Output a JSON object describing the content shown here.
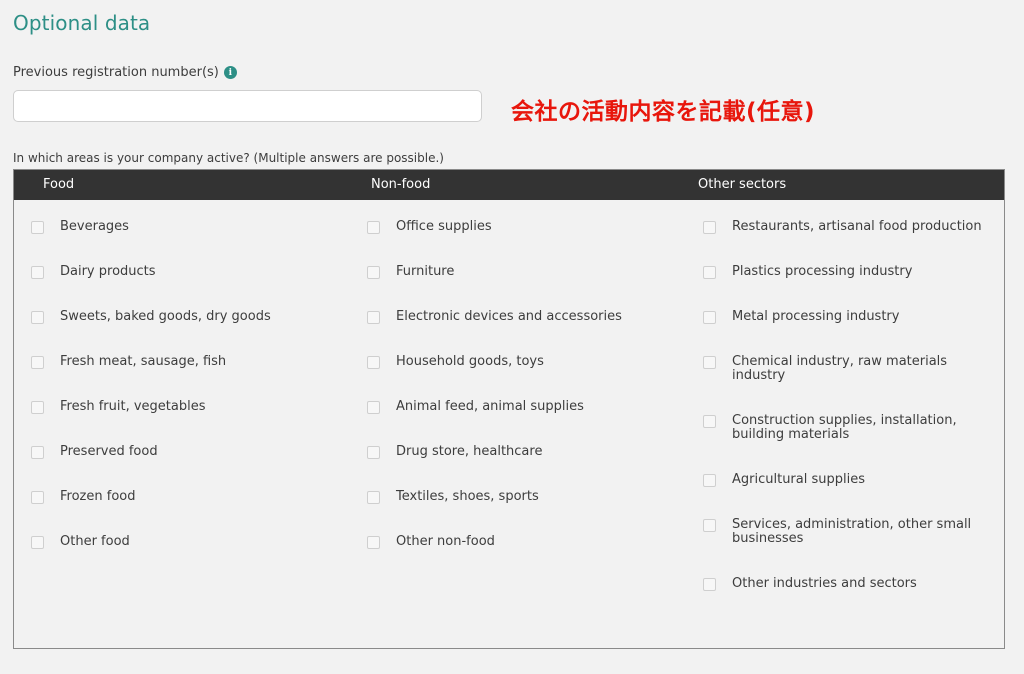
{
  "section": {
    "title": "Optional data"
  },
  "registration": {
    "label": "Previous registration number(s)",
    "info_glyph": "i",
    "value": "",
    "placeholder": ""
  },
  "annotation": {
    "text": "会社の活動内容を記載(任意)",
    "color": "#e8160c"
  },
  "areas": {
    "question": "In which areas is your company active? (Multiple answers are possible.)",
    "columns": [
      {
        "header": "Food",
        "options": [
          "Beverages",
          "Dairy products",
          "Sweets, baked goods, dry goods",
          "Fresh meat, sausage, fish",
          "Fresh fruit, vegetables",
          "Preserved food",
          "Frozen food",
          "Other food"
        ]
      },
      {
        "header": "Non-food",
        "options": [
          "Office supplies",
          "Furniture",
          "Electronic devices and accessories",
          "Household goods, toys",
          "Animal feed, animal supplies",
          "Drug store, healthcare",
          "Textiles, shoes, sports",
          "Other non-food"
        ]
      },
      {
        "header": "Other sectors",
        "options": [
          "Restaurants, artisanal food production",
          "Plastics processing industry",
          "Metal processing industry",
          "Chemical industry, raw materials industry",
          "Construction supplies, installation, building materials",
          "Agricultural supplies",
          "Services, administration, other small businesses",
          "Other industries and sectors"
        ]
      }
    ]
  },
  "colors": {
    "accent": "#2d8f86",
    "header_bg": "#333333",
    "page_bg": "#f2f2f2"
  }
}
